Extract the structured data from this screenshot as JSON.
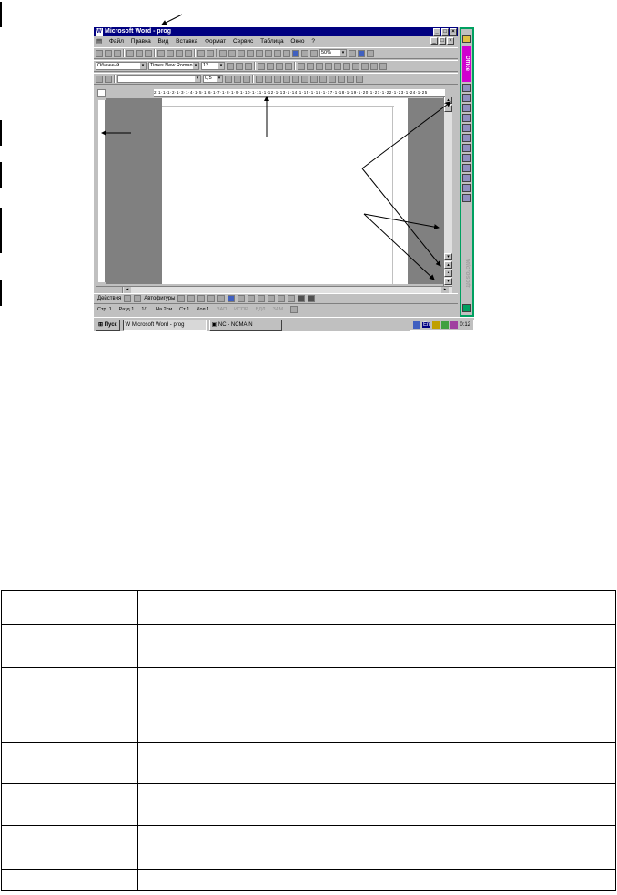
{
  "window": {
    "title": "Microsoft Word - prog",
    "controls": [
      "_",
      "□",
      "×"
    ]
  },
  "menu": {
    "items": [
      "Файл",
      "Правка",
      "Вид",
      "Вставка",
      "Формат",
      "Сервис",
      "Таблица",
      "Окно",
      "?"
    ]
  },
  "toolbar_standard": {
    "zoom": "50%"
  },
  "toolbar_format": {
    "style": "Обычный",
    "font": "Times New Roman",
    "size": "12"
  },
  "toolbar_borders": {
    "line_width": "0,5"
  },
  "ruler": {
    "text": "2·1·1·1·2·1·3·1·4·1·5·1·6·1·7·1·8·1·9·1·10·1·11·1·12·1·13·1·14·1·15·1·16·1·17·1·18·1·19·1·20·1·21·1·22·1·23·1·24·1·25"
  },
  "drawing_toolbar": {
    "actions": "Действия",
    "autoshapes": "Автофигуры"
  },
  "status": {
    "page": "Стр. 1",
    "section": "Разд 1",
    "pages": "1/1",
    "at": "На 2см",
    "line": "Ст 1",
    "col": "Кол 1",
    "modes": [
      "ЗАП",
      "ИСПР",
      "ВДЛ",
      "ЗАМ"
    ]
  },
  "office_bar": {
    "label": "Office",
    "brand": "Microsoft"
  },
  "taskbar": {
    "start": "Пуск",
    "app1": "Microsoft Word - prog",
    "app2": "NC - NCMAIN",
    "tray_lang": "En",
    "clock": "0:12"
  }
}
